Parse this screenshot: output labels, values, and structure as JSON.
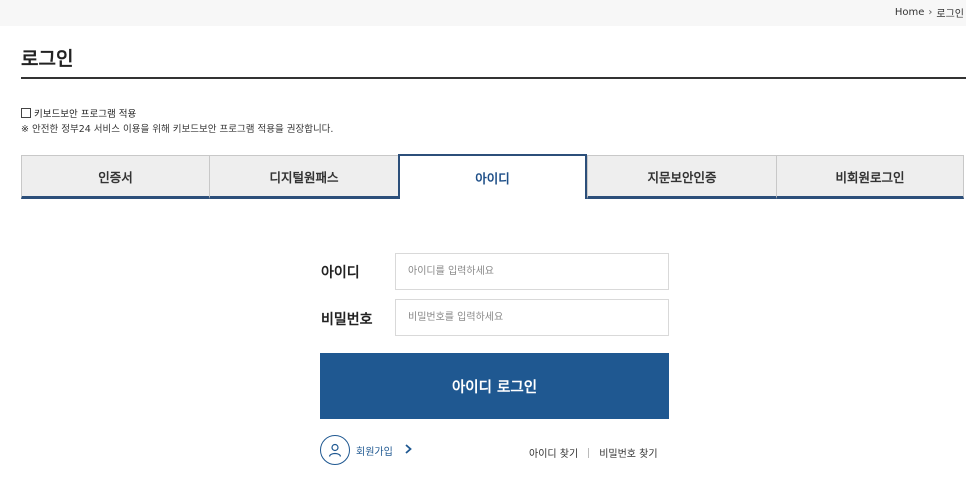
{
  "breadcrumb": {
    "home": "Home",
    "separator": "›",
    "current": "로그인"
  },
  "page": {
    "title": "로그인"
  },
  "keyboard_security": {
    "checkbox_label": "키보드보안 프로그램 적용",
    "checked": false,
    "note": "※ 안전한 정부24 서비스 이용을 위해 키보드보안 프로그램 적용을 권장합니다."
  },
  "tabs": [
    {
      "label": "인증서",
      "active": false
    },
    {
      "label": "디지털원패스",
      "active": false
    },
    {
      "label": "아이디",
      "active": true
    },
    {
      "label": "지문보안인증",
      "active": false
    },
    {
      "label": "비회원로그인",
      "active": false
    }
  ],
  "form": {
    "id_label": "아이디",
    "id_placeholder": "아이디를 입력하세요",
    "id_value": "",
    "pw_label": "비밀번호",
    "pw_placeholder": "비밀번호를 입력하세요",
    "pw_value": "",
    "submit_label": "아이디 로그인"
  },
  "footer_links": {
    "signup": "회원가입",
    "find_id": "아이디 찾기",
    "find_pw": "비밀번호 찾기"
  },
  "colors": {
    "accent": "#1f5891",
    "tab_border": "#2c4f7a",
    "active_tab_text": "#1e4f88"
  },
  "icons": {
    "signup": "user-icon",
    "signup_arrow": "chevron-right-icon",
    "breadcrumb_separator": "chevron-right-icon"
  }
}
